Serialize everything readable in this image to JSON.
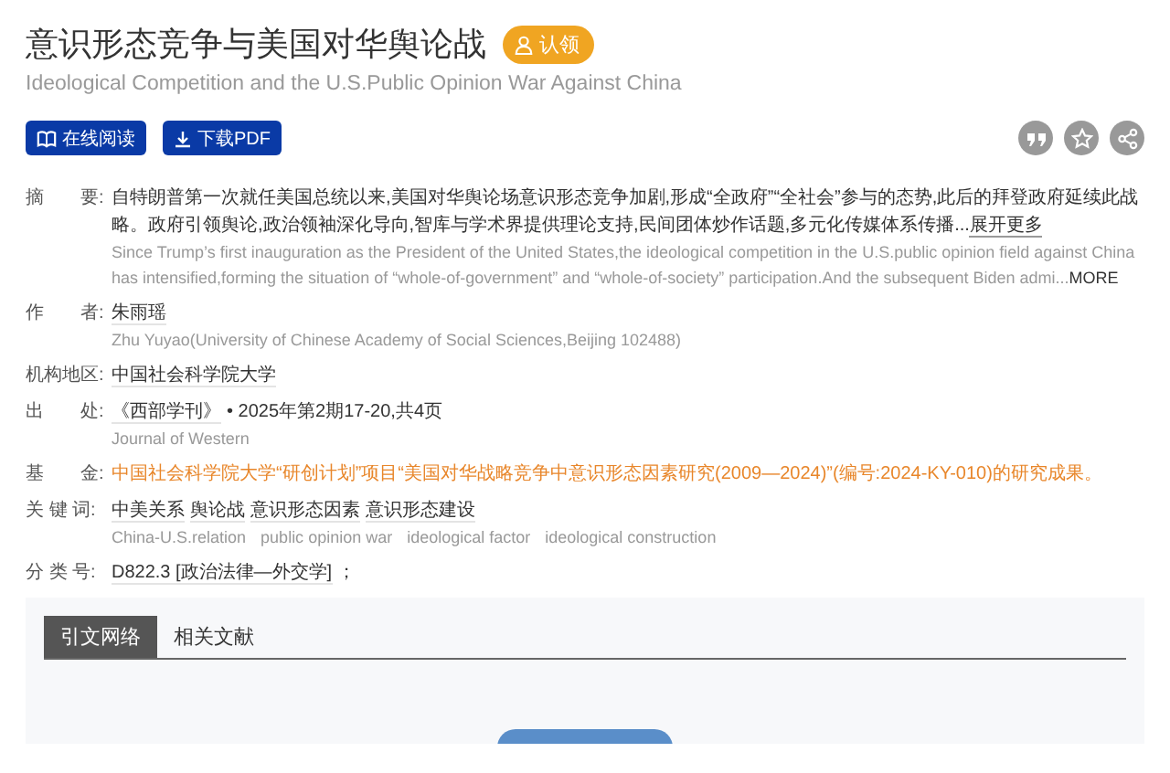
{
  "title": "意识形态竞争与美国对华舆论战",
  "claim_badge": "认领",
  "subtitle": "Ideological Competition and the U.S.Public Opinion War Against China",
  "actions": [
    {
      "kind": "read",
      "label": "在线阅读"
    },
    {
      "kind": "download",
      "label": "下载PDF"
    }
  ],
  "tools": [
    {
      "kind": "quote"
    },
    {
      "kind": "star"
    },
    {
      "kind": "share"
    }
  ],
  "fields": [
    {
      "kind": "abstract",
      "label": "摘　　要:",
      "text": "自特朗普第一次就任美国总统以来,美国对华舆论场意识形态竞争加剧,形成“全政府”“全社会”参与的态势,此后的拜登政府延续此战略。政府引领舆论,政治领袖深化导向,智库与学术界提供理论支持,民间团体炒作话题,多元化传媒体系传播...",
      "more": "展开更多",
      "text_en": "Since Trump’s first inauguration as the President of the United States,the ideological competition in the U.S.public opinion field against China has intensified,forming the situation of “whole-of-government” and “whole-of-society” participation.And the subsequent Biden admi...",
      "more_en": "MORE"
    },
    {
      "kind": "links",
      "label": "作　　者:",
      "links": [
        "朱雨瑶"
      ],
      "text_en": "Zhu Yuyao(University of Chinese Academy of Social Sciences,Beijing 102488)"
    },
    {
      "kind": "links",
      "label": "机构地区:",
      "links": [
        "中国社会科学院大学"
      ]
    },
    {
      "kind": "source",
      "label": "出　　处:",
      "links": [
        "《西部学刊》"
      ],
      "text": "• 2025年第2期17-20,共4页",
      "text_en": "Journal of Western"
    },
    {
      "kind": "fund",
      "label": "基　　金:",
      "text": "中国社会科学院大学“研创计划”项目“美国对华战略竞争中意识形态因素研究(2009—2024)”(编号:2024-KY-010)的研究成果。"
    },
    {
      "kind": "keywords",
      "label": "关 键 词:",
      "links": [
        "中美关系",
        "舆论战",
        "意识形态因素",
        "意识形态建设"
      ],
      "keywords_en": [
        "China-U.S.relation",
        "public opinion war",
        "ideological factor",
        "ideological construction"
      ]
    },
    {
      "kind": "links",
      "label": "分 类 号:",
      "links": [
        "D822.3 [政治法律—外交学]"
      ],
      "text": "；"
    }
  ],
  "tabs": [
    {
      "label": "引文网络",
      "selected": true
    },
    {
      "label": "相关文献",
      "selected": false
    }
  ]
}
